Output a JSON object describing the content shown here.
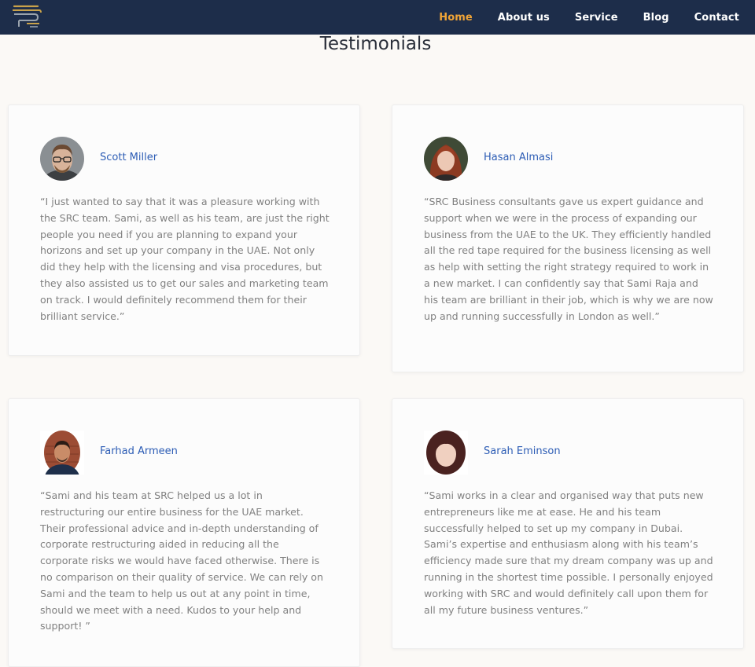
{
  "nav": {
    "items": [
      {
        "label": "Home",
        "active": true
      },
      {
        "label": "About us",
        "active": false
      },
      {
        "label": "Service",
        "active": false
      },
      {
        "label": "Blog",
        "active": false
      },
      {
        "label": "Contact",
        "active": false
      }
    ],
    "active_color": "#f0a437",
    "background": "#1d2d4a"
  },
  "page": {
    "title": "Testimonials"
  },
  "testimonials": [
    {
      "name": "Scott Miller",
      "avatar": "man-with-glasses-photo",
      "quote": "“I just wanted to say that it was a pleasure working with the SRC team. Sami, as well as his team, are just the right people you need if you are planning to expand your horizons and set up your company in the UAE. Not only did they help with the licensing and visa procedures, but they also assisted us to get our sales and marketing team on track. I would definitely recommend them for their brilliant service.”"
    },
    {
      "name": "Hasan Almasi",
      "avatar": "woman-red-hair-photo",
      "quote": "“SRC Business consultants gave us expert guidance and support when we were in the process of expanding our business from the UAE to the UK. They efficiently handled all the red tape required for the business licensing as well as help with setting the right strategy required to work in a new market. I can confidently say that Sami Raja and his team are brilliant in their job, which is why we are now up and running successfully in London as well.”"
    },
    {
      "name": "Farhad Armeen",
      "avatar": "man-brick-wall-photo",
      "quote": "“Sami and his team at SRC helped us a lot in restructuring our entire business for the UAE market. Their professional advice and in-depth understanding of corporate restructuring aided in reducing all the corporate risks we would have faced otherwise. There is no comparison on their quality of service. We can rely on Sami and the team to help us out at any point in time, should we meet with a need. Kudos to your help and support! ”"
    },
    {
      "name": "Sarah Eminson",
      "avatar": "smiling-woman-photo",
      "quote": "“Sami works in a clear and organised way that puts new entrepreneurs like me at ease. He and his team successfully helped to set up my company in Dubai. Sami’s expertise and enthusiasm along with his team’s efficiency made sure that my dream company was up and running in the shortest time possible. I personally enjoyed working with SRC and would definitely call upon them for all my future business ventures.”"
    }
  ]
}
